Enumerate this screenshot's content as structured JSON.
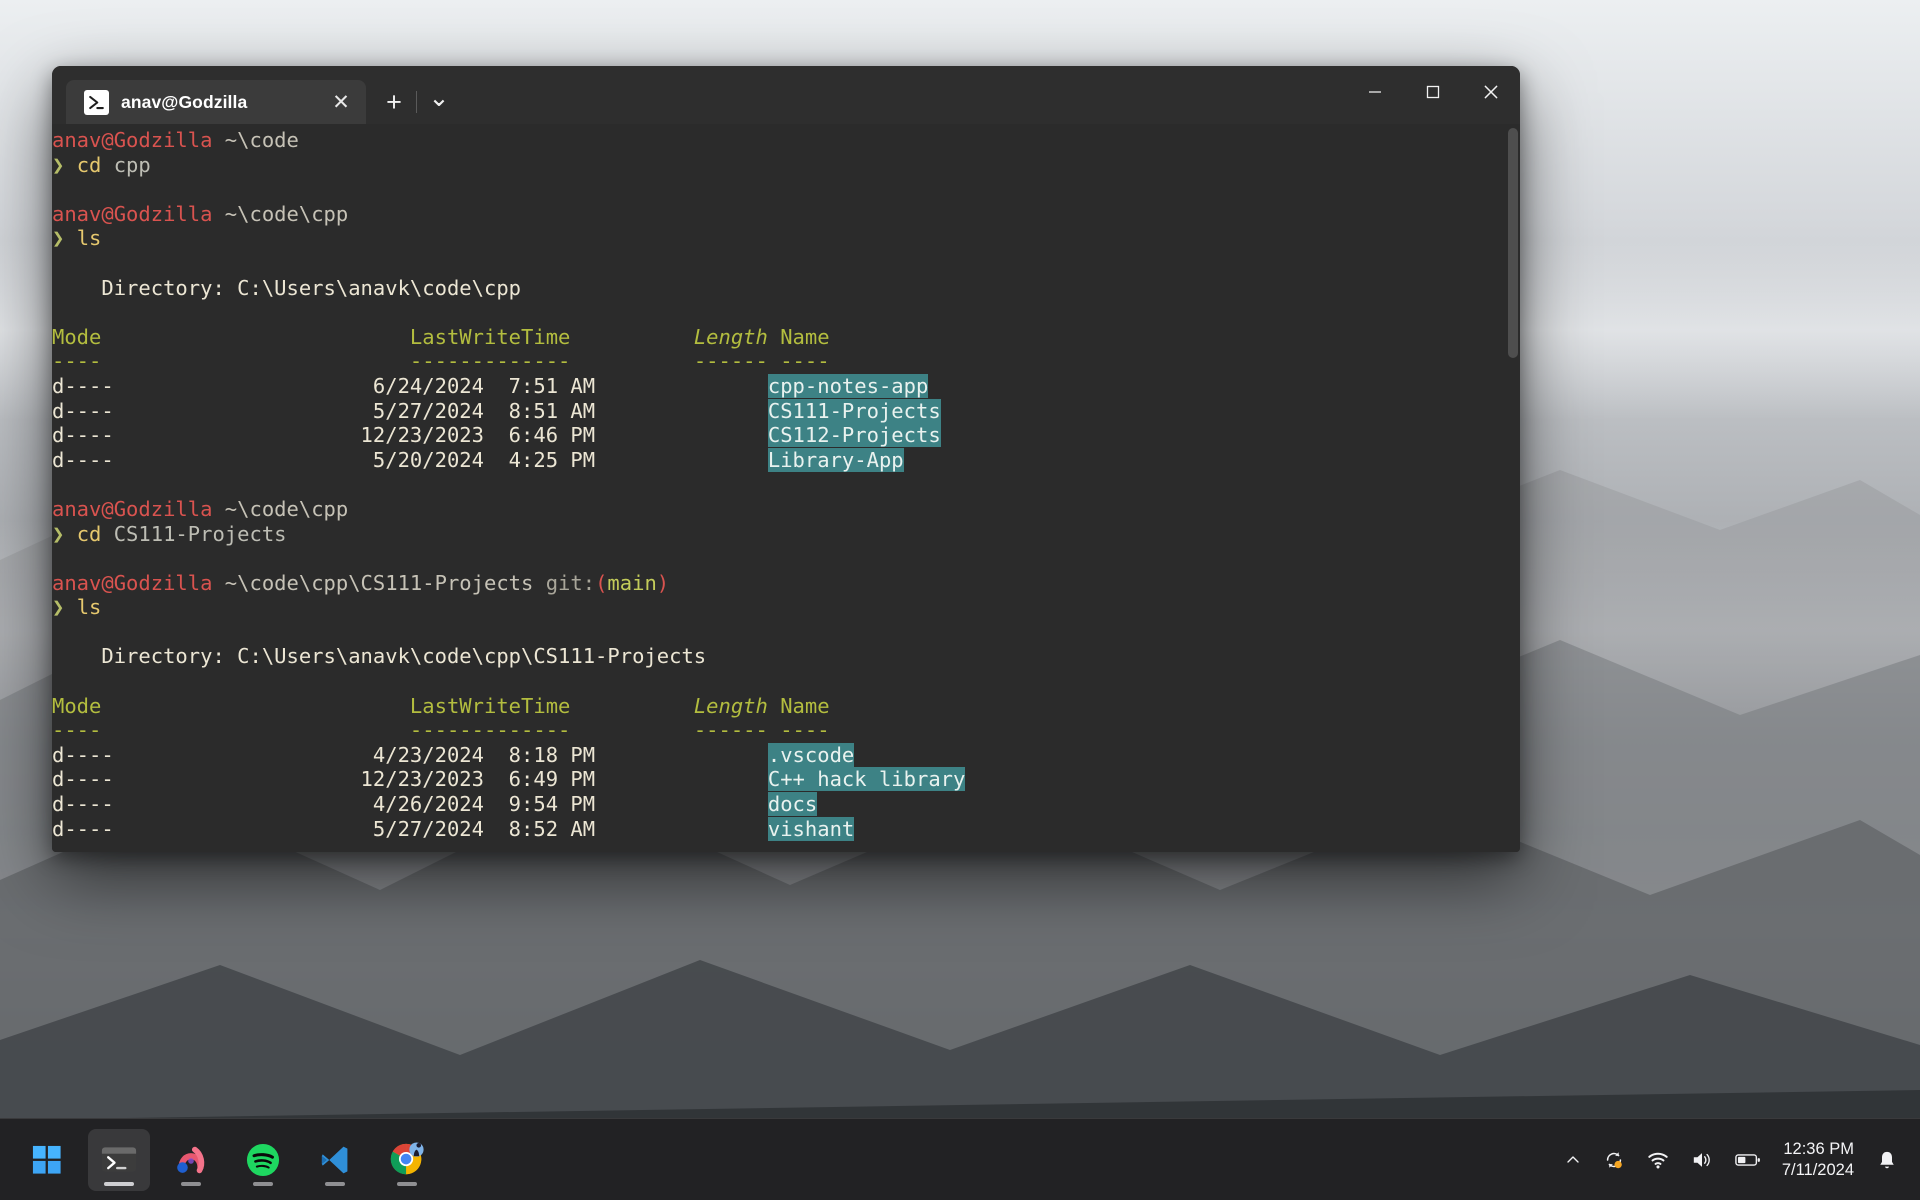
{
  "window": {
    "tab_title": "anav@Godzilla",
    "tab_icon": "powershell-icon",
    "close_glyph": "✕",
    "newtab_glyph": "+",
    "dropdown_glyph": "⌄",
    "minimize_glyph": "─",
    "maximize_glyph": "□",
    "appclose_glyph": "✕"
  },
  "terminal": {
    "user_host": "anav@Godzilla",
    "prompt_symbol": "❯",
    "blocks": [
      {
        "prompt": {
          "user": "anav@Godzilla",
          "path": "~\\code",
          "git": ""
        },
        "command": "cd",
        "args": "cpp"
      },
      {
        "prompt": {
          "user": "anav@Godzilla",
          "path": "~\\code\\cpp",
          "git": ""
        },
        "command": "ls",
        "args": "",
        "listing": {
          "directory_label": "    Directory: C:\\Users\\anavk\\code\\cpp",
          "headers": {
            "mode": "Mode",
            "lastwritetime": "LastWriteTime",
            "length": "Length",
            "name": "Name"
          },
          "rules": {
            "mode": "----",
            "lastwritetime": "-------------",
            "length": "------",
            "name": "----"
          },
          "rows": [
            {
              "mode": "d----",
              "date": "6/24/2024",
              "time": "7:51 AM",
              "length": "",
              "name": "cpp-notes-app"
            },
            {
              "mode": "d----",
              "date": "5/27/2024",
              "time": "8:51 AM",
              "length": "",
              "name": "CS111-Projects"
            },
            {
              "mode": "d----",
              "date": "12/23/2023",
              "time": "6:46 PM",
              "length": "",
              "name": "CS112-Projects"
            },
            {
              "mode": "d----",
              "date": "5/20/2024",
              "time": "4:25 PM",
              "length": "",
              "name": "Library-App"
            }
          ]
        }
      },
      {
        "prompt": {
          "user": "anav@Godzilla",
          "path": "~\\code\\cpp",
          "git": ""
        },
        "command": "cd",
        "args": "CS111-Projects"
      },
      {
        "prompt": {
          "user": "anav@Godzilla",
          "path": "~\\code\\cpp\\CS111-Projects",
          "git": "git:(main)",
          "git_label": "git:",
          "git_branch": "main"
        },
        "command": "ls",
        "args": "",
        "listing": {
          "directory_label": "    Directory: C:\\Users\\anavk\\code\\cpp\\CS111-Projects",
          "headers": {
            "mode": "Mode",
            "lastwritetime": "LastWriteTime",
            "length": "Length",
            "name": "Name"
          },
          "rules": {
            "mode": "----",
            "lastwritetime": "-------------",
            "length": "------",
            "name": "----"
          },
          "rows": [
            {
              "mode": "d----",
              "date": "4/23/2024",
              "time": "8:18 PM",
              "length": "",
              "name": ".vscode"
            },
            {
              "mode": "d----",
              "date": "12/23/2023",
              "time": "6:49 PM",
              "length": "",
              "name": "C++ hack library"
            },
            {
              "mode": "d----",
              "date": "4/26/2024",
              "time": "9:54 PM",
              "length": "",
              "name": "docs"
            },
            {
              "mode": "d----",
              "date": "5/27/2024",
              "time": "8:52 AM",
              "length": "",
              "name": "vishant"
            }
          ]
        }
      }
    ]
  },
  "taskbar": {
    "items": [
      {
        "name": "start-button",
        "icon": "windows-logo-icon",
        "active": false,
        "running": false
      },
      {
        "name": "taskbar-terminal",
        "icon": "terminal-icon",
        "active": true,
        "running": true
      },
      {
        "name": "taskbar-arc",
        "icon": "arc-browser-icon",
        "active": false,
        "running": true
      },
      {
        "name": "taskbar-spotify",
        "icon": "spotify-icon",
        "active": false,
        "running": true
      },
      {
        "name": "taskbar-vscode",
        "icon": "vscode-icon",
        "active": false,
        "running": true
      },
      {
        "name": "taskbar-chrome",
        "icon": "chrome-icon",
        "active": false,
        "running": true
      }
    ],
    "tray": [
      {
        "name": "tray-overflow",
        "icon": "chevron-up-icon"
      },
      {
        "name": "tray-onedrive-sync",
        "icon": "sync-icon"
      },
      {
        "name": "tray-network",
        "icon": "wifi-icon"
      },
      {
        "name": "tray-volume",
        "icon": "speaker-icon"
      },
      {
        "name": "tray-battery",
        "icon": "battery-icon"
      }
    ],
    "clock": {
      "time": "12:36 PM",
      "date": "7/11/2024"
    },
    "notifications_icon": "bell-icon"
  },
  "colors": {
    "terminal_bg": "#2b2b2b",
    "titlebar_bg": "#2e2e2e",
    "tab_bg": "#3b3b3b",
    "prompt_user": "#d9534f",
    "prompt_path": "#c6c2b6",
    "prompt_chevron": "#b5bd68",
    "command": "#e6c86e",
    "header": "#b3bd3f",
    "output": "#ece6d4",
    "dir_highlight": "#3d8285",
    "taskbar_bg": "#222224"
  }
}
